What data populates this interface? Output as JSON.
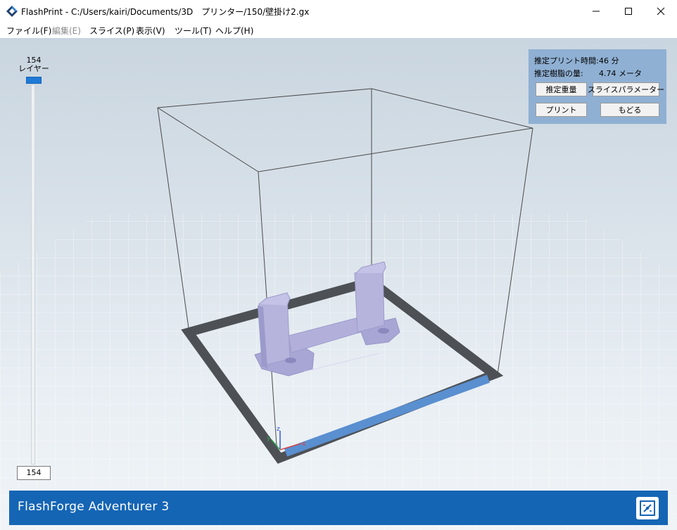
{
  "window": {
    "title": "FlashPrint - C:/Users/kairi/Documents/3D　プリンター/150/壁掛け2.gx"
  },
  "menu": {
    "items": [
      {
        "label": "ファイル(F)",
        "enabled": true
      },
      {
        "label": "編集(E)",
        "enabled": false
      },
      {
        "label": "スライス(P)",
        "enabled": true
      },
      {
        "label": "表示(V)",
        "enabled": true
      },
      {
        "label": "ツール(T)",
        "enabled": true
      },
      {
        "label": "ヘルプ(H)",
        "enabled": true
      }
    ]
  },
  "layer_slider": {
    "max_layer": "154",
    "label": "レイヤー",
    "current_value": "154"
  },
  "info_panel": {
    "print_time_label": "推定プリント時間:",
    "print_time_value": "46 分",
    "filament_label": "推定樹脂の量:",
    "filament_value": "4.74 メータ",
    "estimate_weight_button": "推定重量",
    "slice_params_button": "スライスパラメーター",
    "print_button": "プリント",
    "back_button": "もどる"
  },
  "axes": {
    "x": "x",
    "y": "y",
    "z": "z"
  },
  "status_bar": {
    "printer_name": "FlashForge Adventurer 3",
    "connect_icon": "connection-icon"
  },
  "colors": {
    "accent_blue": "#1565b5",
    "panel_blue": "#8fb0d3",
    "model": "#b6b4dc",
    "slider_thumb": "#1e7ad6"
  }
}
